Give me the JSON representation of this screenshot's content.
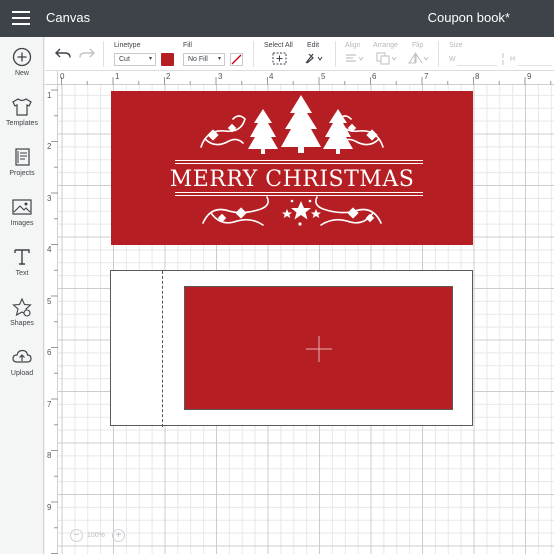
{
  "topbar": {
    "app_title": "Canvas",
    "document_title": "Coupon book*"
  },
  "sidebar": {
    "items": [
      {
        "label": "New",
        "icon": "plus-circle-icon"
      },
      {
        "label": "Templates",
        "icon": "shirt-icon"
      },
      {
        "label": "Projects",
        "icon": "projects-icon"
      },
      {
        "label": "Images",
        "icon": "image-icon"
      },
      {
        "label": "Text",
        "icon": "text-icon"
      },
      {
        "label": "Shapes",
        "icon": "shapes-icon"
      },
      {
        "label": "Upload",
        "icon": "upload-cloud-icon"
      }
    ]
  },
  "toolbar": {
    "linetype_label": "Linetype",
    "linetype_value": "Cut",
    "fill_label": "Fill",
    "fill_value": "No Fill",
    "select_all_label": "Select All",
    "edit_label": "Edit",
    "align_label": "Align",
    "arrange_label": "Arrange",
    "flip_label": "Flip",
    "size_label": "Size",
    "size_w": "W",
    "size_h": "H",
    "swatch_color": "#b51e22"
  },
  "rulers": {
    "top": [
      "0",
      "1",
      "2",
      "3",
      "4",
      "5",
      "6",
      "7",
      "8",
      "9"
    ],
    "left": [
      "1",
      "2",
      "3",
      "4",
      "5",
      "6",
      "7",
      "8",
      "9"
    ]
  },
  "canvas": {
    "card_text": "MERRY CHRISTMAS",
    "card_color": "#b51e22"
  },
  "zoom": {
    "value": "100%",
    "minus": "−",
    "plus": "+"
  }
}
